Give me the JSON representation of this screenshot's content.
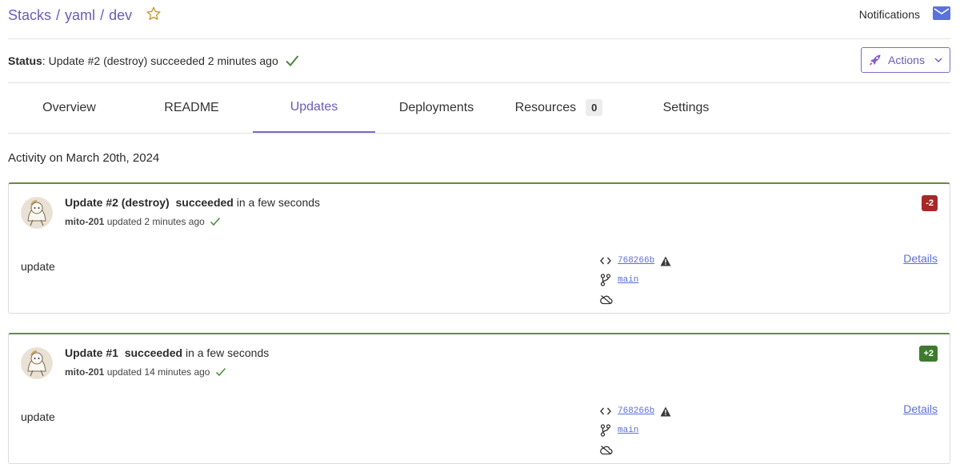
{
  "breadcrumb": {
    "stacks": "Stacks",
    "sep": "/",
    "project": "yaml",
    "stack": "dev"
  },
  "header": {
    "notifications_label": "Notifications"
  },
  "status": {
    "label": "Status",
    "text": "Update #2 (destroy) succeeded 2 minutes ago"
  },
  "actions": {
    "label": "Actions"
  },
  "tabs": [
    {
      "label": "Overview"
    },
    {
      "label": "README"
    },
    {
      "label": "Updates"
    },
    {
      "label": "Deployments"
    },
    {
      "label": "Resources",
      "count": "0"
    },
    {
      "label": "Settings"
    }
  ],
  "activity_heading": "Activity on March 20th, 2024",
  "updates": [
    {
      "title": "Update #2 (destroy)",
      "result": "succeeded",
      "when": "in a few seconds",
      "user": "mito-201",
      "updated_text": "updated 2 minutes ago",
      "badge": "-2",
      "badge_color": "#a82828",
      "message": "update",
      "commit": "768266b",
      "branch": "main",
      "details": "Details"
    },
    {
      "title": "Update #1",
      "result": "succeeded",
      "when": "in a few seconds",
      "user": "mito-201",
      "updated_text": "updated 14 minutes ago",
      "badge": "+2",
      "badge_color": "#3e7a2e",
      "message": "update",
      "commit": "768266b",
      "branch": "main",
      "details": "Details"
    }
  ],
  "icons": {
    "star": "star-icon",
    "envelope": "envelope-icon",
    "check": "check-icon",
    "rocket": "rocket-icon",
    "chevron": "chevron-down-icon",
    "code": "code-icon",
    "warning": "warning-icon",
    "branch": "git-branch-icon",
    "cloud": "cloud-off-icon"
  },
  "colors": {
    "accent": "#6d5bb7",
    "success": "#4a8a3c",
    "link": "#5a6fd8"
  }
}
